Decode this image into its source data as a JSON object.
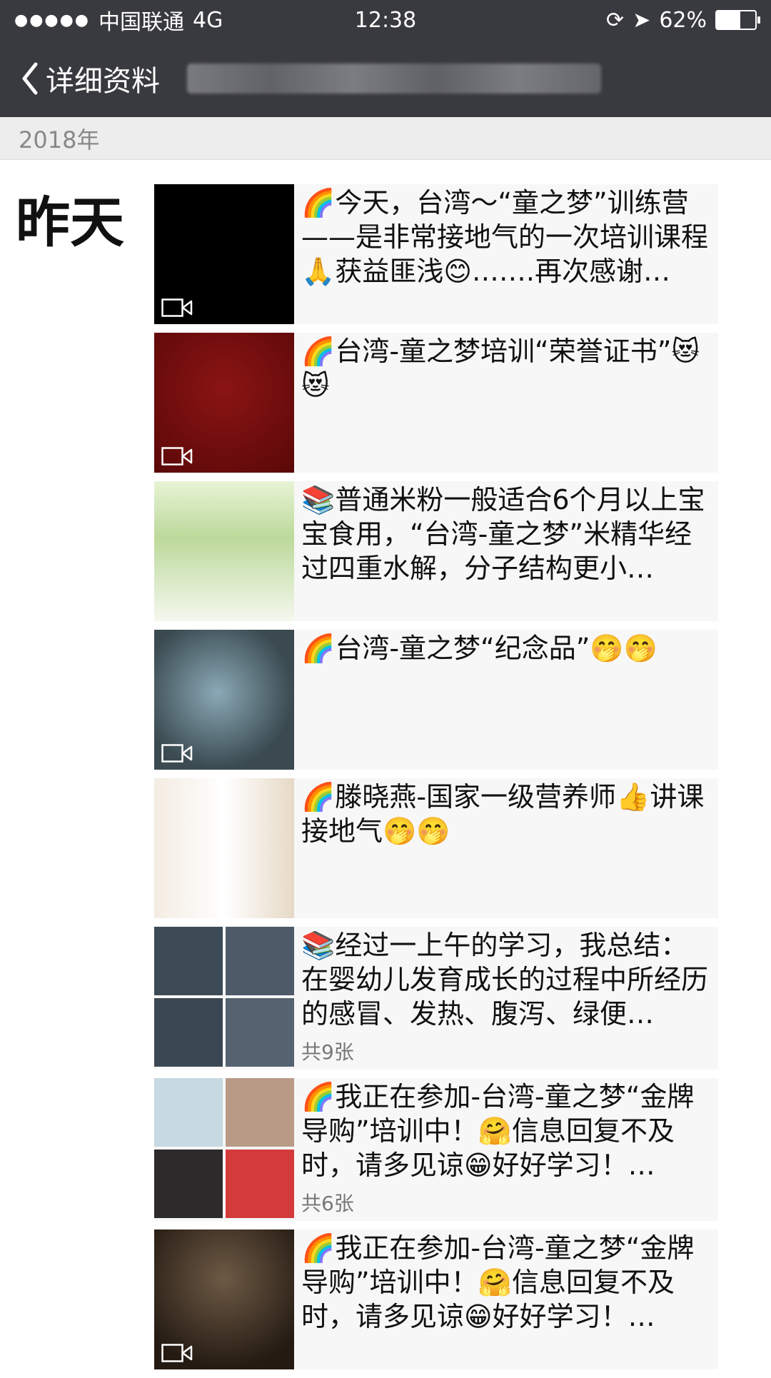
{
  "status": {
    "carrier": "中国联通",
    "network": "4G",
    "time": "12:38",
    "battery": "62%",
    "battery_level": 0.62
  },
  "nav": {
    "back_label": "详细资料"
  },
  "year": "2018年",
  "day": "昨天",
  "posts": [
    {
      "text": "🌈今天，台湾～“童之梦”训练营——是非常接地气的一次培训课程🙏获益匪浅😊…….再次感谢…",
      "thumb": "video"
    },
    {
      "text": "🌈台湾-童之梦培训“荣誉证书”😻😻",
      "thumb": "video"
    },
    {
      "text": "📚普通米粉一般适合6个月以上宝宝食用，“台湾-童之梦”米精华经过四重水解，分子结构更小…",
      "thumb": "image"
    },
    {
      "text": "🌈台湾-童之梦“纪念品”🤭🤭",
      "thumb": "video"
    },
    {
      "text": "🌈滕晓燕-国家一级营养师👍讲课接地气🤭🤭",
      "thumb": "image"
    },
    {
      "text": "📚经过一上午的学习，我总结：在婴幼儿发育成长的过程中所经历的感冒、发热、腹泻、绿便…",
      "thumb": "grid",
      "count": "共9张"
    },
    {
      "text": "🌈我正在参加-台湾-童之梦“金牌导购”培训中！🤗信息回复不及时，请多见谅😁好好学习！…",
      "thumb": "grid",
      "count": "共6张"
    },
    {
      "text": "🌈我正在参加-台湾-童之梦“金牌导购”培训中！🤗信息回复不及时，请多见谅😁好好学习！…",
      "thumb": "video"
    }
  ]
}
